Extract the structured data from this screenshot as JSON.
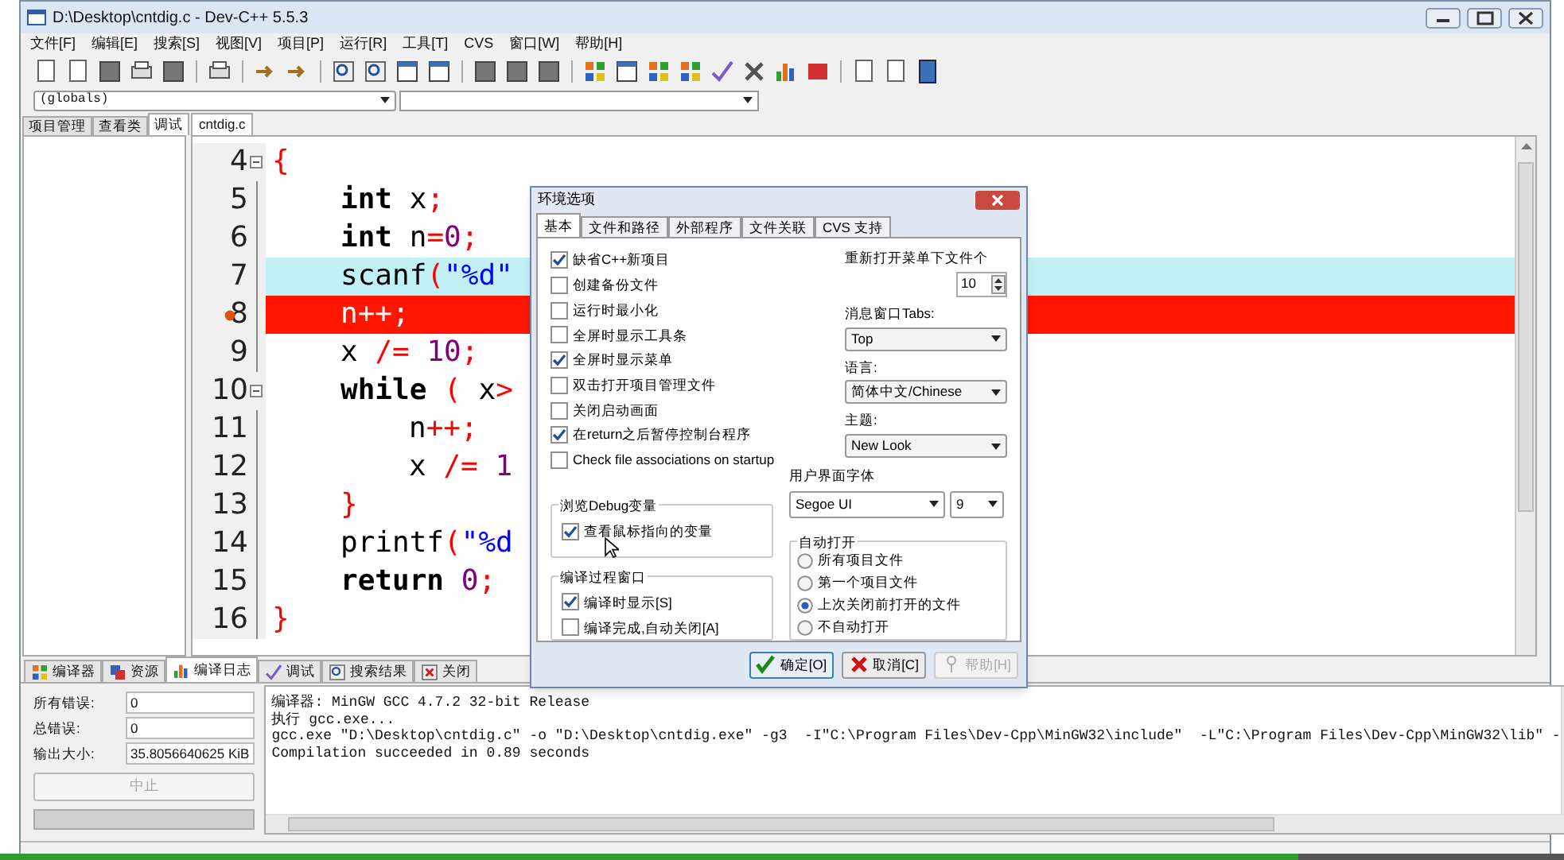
{
  "window": {
    "title": "D:\\Desktop\\cntdig.c - Dev-C++ 5.5.3"
  },
  "menu": [
    "文件[F]",
    "编辑[E]",
    "搜索[S]",
    "视图[V]",
    "项目[P]",
    "运行[R]",
    "工具[T]",
    "CVS",
    "窗口[W]",
    "帮助[H]"
  ],
  "scope_selector": {
    "value": "(globals)"
  },
  "left_tabs": [
    {
      "label": "项目管理",
      "selected": false
    },
    {
      "label": "查看类",
      "selected": false
    },
    {
      "label": "调试",
      "selected": true
    }
  ],
  "editor": {
    "tab": "cntdig.c",
    "lines": [
      {
        "number": "4",
        "fold": true,
        "tokens": [
          {
            "kind": "op",
            "text": "{"
          }
        ],
        "children": [
          {
            "number": "5",
            "tokens": [
              {
                "kind": "kw",
                "text": "int"
              },
              {
                "kind": "id",
                "text": " x"
              },
              {
                "kind": "op",
                "text": ";"
              }
            ]
          },
          {
            "number": "6",
            "tokens": [
              {
                "kind": "kw",
                "text": "int"
              },
              {
                "kind": "id",
                "text": " n"
              },
              {
                "kind": "op",
                "text": "="
              },
              {
                "kind": "num",
                "text": "0"
              },
              {
                "kind": "op",
                "text": ";"
              }
            ]
          },
          {
            "number": "7",
            "current": true,
            "tokens": [
              {
                "kind": "id",
                "text": "scanf"
              },
              {
                "kind": "op",
                "text": "("
              },
              {
                "kind": "str",
                "text": "\"%d\""
              }
            ]
          },
          {
            "number": "8",
            "breakpoint": true,
            "tokens": [
              {
                "kind": "id",
                "text": "n"
              },
              {
                "kind": "op",
                "text": "++;"
              }
            ]
          },
          {
            "number": "9",
            "tokens": [
              {
                "kind": "id",
                "text": "x "
              },
              {
                "kind": "op",
                "text": "/= "
              },
              {
                "kind": "num",
                "text": "10"
              },
              {
                "kind": "op",
                "text": ";"
              }
            ]
          },
          {
            "number": "10",
            "fold": true,
            "tokens": [
              {
                "kind": "kw",
                "text": "while"
              },
              {
                "kind": "op",
                "text": " ("
              },
              {
                "kind": "id",
                "text": " x"
              },
              {
                "kind": "op",
                "text": ">"
              }
            ],
            "children": [
              {
                "number": "11",
                "tokens": [
                  {
                    "kind": "id",
                    "text": "n"
                  },
                  {
                    "kind": "op",
                    "text": "++;"
                  }
                ]
              },
              {
                "number": "12",
                "tokens": [
                  {
                    "kind": "id",
                    "text": "x "
                  },
                  {
                    "kind": "op",
                    "text": "/= "
                  },
                  {
                    "kind": "num",
                    "text": "1"
                  }
                ]
              }
            ]
          },
          {
            "number": "13",
            "tokens": [
              {
                "kind": "op",
                "text": "}"
              }
            ]
          },
          {
            "number": "14",
            "tokens": [
              {
                "kind": "id",
                "text": "printf"
              },
              {
                "kind": "op",
                "text": "("
              },
              {
                "kind": "str",
                "text": "\"%d"
              }
            ]
          },
          {
            "number": "15",
            "tokens": [
              {
                "kind": "kw",
                "text": "return"
              },
              {
                "kind": "num",
                "text": " 0"
              },
              {
                "kind": "op",
                "text": ";"
              }
            ]
          }
        ]
      },
      {
        "number": "16",
        "tokens": [
          {
            "kind": "op",
            "text": "}"
          }
        ]
      }
    ]
  },
  "dialog": {
    "title": "环境选项",
    "tabs": [
      {
        "label": "基本",
        "selected": true
      },
      {
        "label": "文件和路径",
        "selected": false
      },
      {
        "label": "外部程序",
        "selected": false
      },
      {
        "label": "文件关联",
        "selected": false
      },
      {
        "label": "CVS 支持",
        "selected": false
      }
    ],
    "options": [
      {
        "label": "缺省C++新项目",
        "checked": true
      },
      {
        "label": "创建备份文件",
        "checked": false
      },
      {
        "label": "运行时最小化",
        "checked": false
      },
      {
        "label": "全屏时显示工具条",
        "checked": false
      },
      {
        "label": "全屏时显示菜单",
        "checked": true
      },
      {
        "label": "双击打开项目管理文件",
        "checked": false
      },
      {
        "label": "关闭启动画面",
        "checked": false
      },
      {
        "label": "在return之后暂停控制台程序",
        "checked": true
      },
      {
        "label": "Check file associations on startup",
        "checked": false
      }
    ],
    "reopen_count": {
      "label": "重新打开菜单下文件个",
      "value": "10"
    },
    "selects": [
      {
        "label": "消息窗口Tabs:",
        "value": "Top"
      },
      {
        "label": "语言:",
        "value": "简体中文/Chinese"
      },
      {
        "label": "主题:",
        "value": "New Look"
      }
    ],
    "ui_font": {
      "label": "用户界面字体",
      "font": "Segoe UI",
      "size": "9"
    },
    "debug_group": {
      "title": "浏览Debug变量",
      "options": [
        {
          "label": "查看鼠标指向的变量",
          "checked": true
        }
      ]
    },
    "compile_group": {
      "title": "编译过程窗口",
      "options": [
        {
          "label": "编译时显示[S]",
          "checked": true
        },
        {
          "label": "编译完成,自动关闭[A]",
          "checked": false
        }
      ]
    },
    "auto_open": {
      "title": "自动打开",
      "options": [
        {
          "label": "所有项目文件",
          "selected": false
        },
        {
          "label": "第一个项目文件",
          "selected": false
        },
        {
          "label": "上次关闭前打开的文件",
          "selected": true
        },
        {
          "label": "不自动打开",
          "selected": false
        }
      ]
    },
    "buttons": [
      {
        "label": "确定[O]",
        "kind": "ok",
        "disabled": false
      },
      {
        "label": "取消[C]",
        "kind": "cancel",
        "disabled": false
      },
      {
        "label": "帮助[H]",
        "kind": "help",
        "disabled": true
      }
    ]
  },
  "bottom_tabs": [
    {
      "label": "编译器",
      "kind": "grid",
      "selected": false
    },
    {
      "label": "资源",
      "kind": "stack",
      "selected": false
    },
    {
      "label": "编译日志",
      "kind": "chart",
      "selected": true
    },
    {
      "label": "调试",
      "kind": "check",
      "selected": false
    },
    {
      "label": "搜索结果",
      "kind": "search",
      "selected": false
    },
    {
      "label": "关闭",
      "kind": "close",
      "selected": false
    }
  ],
  "compile_stats": [
    {
      "label": "所有错误:",
      "value": "0"
    },
    {
      "label": "总错误:",
      "value": "0"
    },
    {
      "label": "输出大小:",
      "value": "35.8056640625 KiB"
    }
  ],
  "abort_button": {
    "label": "中止",
    "disabled": true
  },
  "compile_progress": {
    "level": 1
  },
  "log": [
    "编译器: MinGW GCC 4.7.2 32-bit Release",
    "执行 gcc.exe...",
    "gcc.exe \"D:\\Desktop\\cntdig.c\" -o \"D:\\Desktop\\cntdig.exe\" -g3  -I\"C:\\Program Files\\Dev-Cpp\\MinGW32\\include\"  -L\"C:\\Program Files\\Dev-Cpp\\MinGW32\\lib\" -",
    "Compilation succeeded in 0.89 seconds"
  ],
  "video_player": {
    "level": 0.83
  }
}
